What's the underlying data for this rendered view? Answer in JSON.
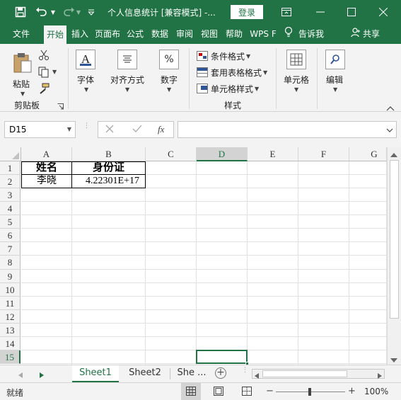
{
  "titlebar": {
    "title": "个人信息统计  [兼容模式]  -...",
    "login": "登录"
  },
  "tabs": [
    {
      "label": "文件",
      "active": false
    },
    {
      "label": "开始",
      "active": true
    },
    {
      "label": "插入",
      "active": false
    },
    {
      "label": "页面布",
      "active": false
    },
    {
      "label": "公式",
      "active": false
    },
    {
      "label": "数据",
      "active": false
    },
    {
      "label": "审阅",
      "active": false
    },
    {
      "label": "视图",
      "active": false
    },
    {
      "label": "帮助",
      "active": false
    },
    {
      "label": "WPS F",
      "active": false
    },
    {
      "label": "告诉我",
      "active": false
    },
    {
      "label": "共享",
      "active": false
    }
  ],
  "ribbon": {
    "paste": "粘贴",
    "clipboard_group": "剪贴板",
    "font": "字体",
    "alignment": "对齐方式",
    "number": "数字",
    "conditional_format": "条件格式",
    "table_format": "套用表格格式",
    "cell_styles": "单元格样式",
    "styles_group": "样式",
    "cells": "单元格",
    "editing": "编辑"
  },
  "formula_bar": {
    "name_box": "D15",
    "fx": "fx",
    "content": ""
  },
  "columns": [
    "A",
    "B",
    "C",
    "D",
    "E",
    "F",
    "G"
  ],
  "rows": [
    "1",
    "2",
    "3",
    "4",
    "5",
    "6",
    "7",
    "8",
    "9",
    "10",
    "11",
    "12",
    "13",
    "14",
    "15"
  ],
  "cells": {
    "A1": "姓名",
    "B1": "身份证",
    "A2": "李晓",
    "B2": "4.22301E+17"
  },
  "sheets": [
    "Sheet1",
    "Sheet2",
    "She ..."
  ],
  "status": {
    "ready": "就绪",
    "zoom": "100%"
  },
  "colors": {
    "accent": "#217346",
    "ribbon_bg": "#f3f3f3"
  }
}
